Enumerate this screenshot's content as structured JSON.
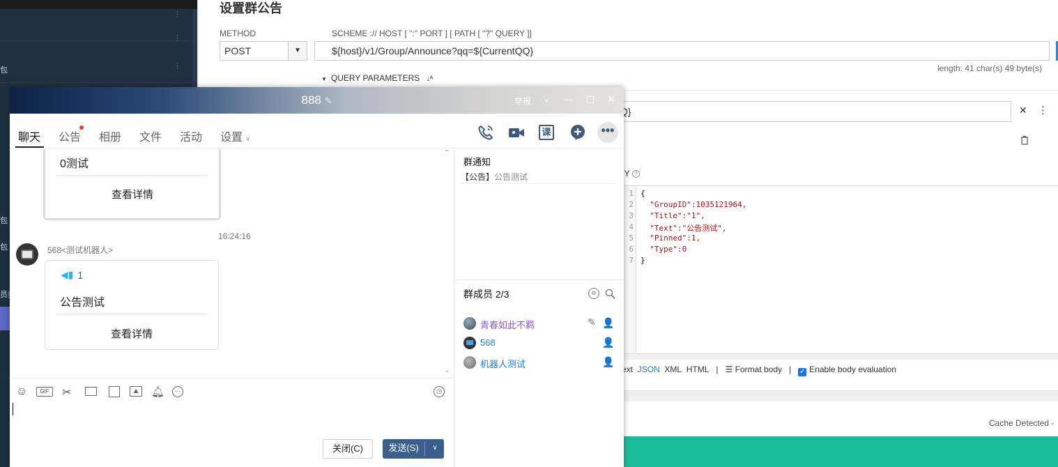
{
  "rest": {
    "title": "设置群公告",
    "method_label": "METHOD",
    "method_value": "POST",
    "url_label": "SCHEME :// HOST [ \":\" PORT ] [ PATH [ \"?\" QUERY ]]",
    "url_value": "${host}/v1/Group/Announce?qq=${CurrentQQ}",
    "length": "length: 41 char(s) 49 byte(s)",
    "query_params": "QUERY PARAMETERS",
    "qq_fragment": "Q}",
    "body_label": "DY",
    "code_lines": [
      "{",
      "  \"GroupID\":1035121964,",
      "  \"Title\":\"1\",",
      "  \"Text\":\"公告测试\",",
      "  \"Pinned\":1,",
      "  \"Type\":0",
      "}"
    ],
    "line_numbers": [
      "1",
      "2",
      "3",
      "4",
      "5",
      "6",
      "7"
    ],
    "body_types": {
      "text": "ext",
      "json": "JSON",
      "xml": "XML",
      "html": "HTML",
      "sep": "|",
      "format": "Format body",
      "enable": "Enable body evaluation"
    },
    "cache": "Cache Detected -"
  },
  "sidebar_glyphs": [
    "包",
    "包",
    "包",
    "员类"
  ],
  "qq": {
    "title": "888",
    "report": "举报",
    "tabs": [
      "聊天",
      "公告",
      "相册",
      "文件",
      "活动",
      "设置"
    ],
    "course_icon": "课",
    "messages": {
      "card1_text": "0测试",
      "card1_link": "查看详情",
      "time": "16:24:16",
      "sender": "568<测试机器人>",
      "card2_title": "1",
      "card2_text": "公告测试",
      "card2_link": "查看详情"
    },
    "notice": {
      "title": "群通知",
      "tag": "【公告】",
      "text": "公告测试"
    },
    "members": {
      "title": "群成员 2/3",
      "list": [
        {
          "name": "青春如此不羁",
          "color": "#8a5cc8"
        },
        {
          "name": "568",
          "color": "#1a7fd6"
        },
        {
          "name": "机器人测试",
          "color": "#1a7fd6"
        }
      ]
    },
    "close_btn": "关闭(C)",
    "send_btn": "发送(S)"
  }
}
